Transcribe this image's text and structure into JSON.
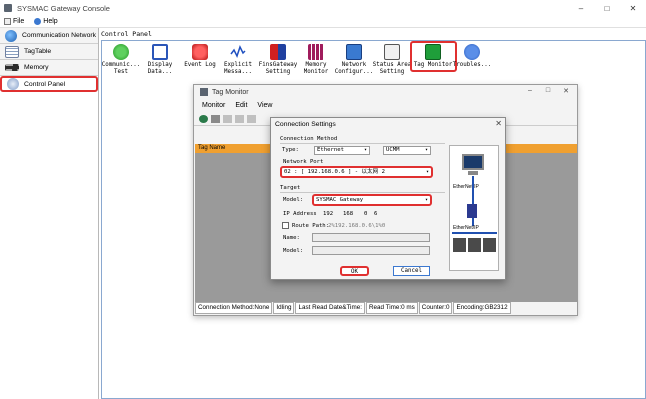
{
  "app": {
    "title": "SYSMAC Gateway Console"
  },
  "window_controls": {
    "minimize": "–",
    "maximize": "□",
    "close": "✕"
  },
  "menu": {
    "file": "File",
    "help": "Help"
  },
  "nav": {
    "items": [
      {
        "label": "Communication Network",
        "icon": "network-globe-icon"
      },
      {
        "label": "TagTable",
        "icon": "table-icon"
      },
      {
        "label": "Memory",
        "icon": "memory-chip-icon"
      },
      {
        "label": "Control Panel",
        "icon": "control-panel-icon",
        "active": true
      }
    ]
  },
  "control_panel": {
    "title": "Control Panel",
    "tools": [
      {
        "label": "Communic...",
        "label2": "Test"
      },
      {
        "label": "Display",
        "label2": "Data..."
      },
      {
        "label": "Event Log",
        "label2": ""
      },
      {
        "label": "Explicit",
        "label2": "Messa..."
      },
      {
        "label": "FinsGateway",
        "label2": "Setting"
      },
      {
        "label": "Memory",
        "label2": "Monitor"
      },
      {
        "label": "Network",
        "label2": "Configur..."
      },
      {
        "label": "Status Area",
        "label2": "Setting"
      },
      {
        "label": "Tag Monitor",
        "label2": ""
      },
      {
        "label": "Troubles...",
        "label2": ""
      }
    ]
  },
  "tag_monitor": {
    "title": "Tag Monitor",
    "menu": [
      "Monitor",
      "Edit",
      "View"
    ],
    "grid_header": "Tag Name",
    "status": [
      "Connection Method:None",
      "Idling",
      "Last Read Date&Time:",
      "Read Time:0 ms",
      "Counter:0",
      "Encoding:GB2312"
    ]
  },
  "connection_settings": {
    "title": "Connection Settings",
    "connection_method_label": "Connection Method",
    "type_label": "Type:",
    "type_value": "Ethernet",
    "protocol_value": "UCMM",
    "network_port_label": "Network Port",
    "network_port_value": "02 : [ 192.168.0.6 ] - 以太网 2",
    "target_label": "Target",
    "model_label": "Model:",
    "model_value": "SYSMAC Gateway",
    "ip_label": "IP Address",
    "ip": [
      "192",
      "168",
      "0",
      "6"
    ],
    "route_path_label": "Route Path:",
    "route_path_value": "2%192.168.0.6\\1%0",
    "name_label": "Name:",
    "model2_label": "Model:",
    "ok": "OK",
    "cancel": "Cancel",
    "diagram_labels": [
      "EtherNet/IP",
      "EtherNet/IP"
    ]
  }
}
